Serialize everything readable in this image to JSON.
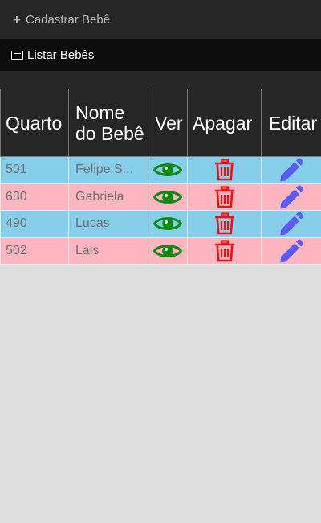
{
  "nav": {
    "cadastrar": {
      "label": "Cadastrar Bebê",
      "icon": "plus-icon"
    },
    "listar": {
      "label": "Listar Bebês",
      "icon": "list-icon"
    }
  },
  "table": {
    "headers": {
      "quarto": "Quarto",
      "nome": "Nome do Bebê",
      "ver": "Ver",
      "apagar": "Apagar",
      "editar": "Editar"
    },
    "rows": [
      {
        "quarto": "501",
        "nome": "Felipe S...",
        "color": "#87ceeb"
      },
      {
        "quarto": "630",
        "nome": "Gabriela",
        "color": "#ffb6c1"
      },
      {
        "quarto": "490",
        "nome": "Lucas",
        "color": "#87ceeb"
      },
      {
        "quarto": "502",
        "nome": "Lais",
        "color": "#ffb6c1"
      }
    ],
    "icons": {
      "ver": "eye-icon",
      "apagar": "trash-icon",
      "editar": "pencil-icon"
    }
  },
  "colors": {
    "eye": "#118a11",
    "trash": "#ee1111",
    "pencil": "#5b5bf5",
    "row_blue": "#87ceeb",
    "row_pink": "#ffb6c1"
  }
}
